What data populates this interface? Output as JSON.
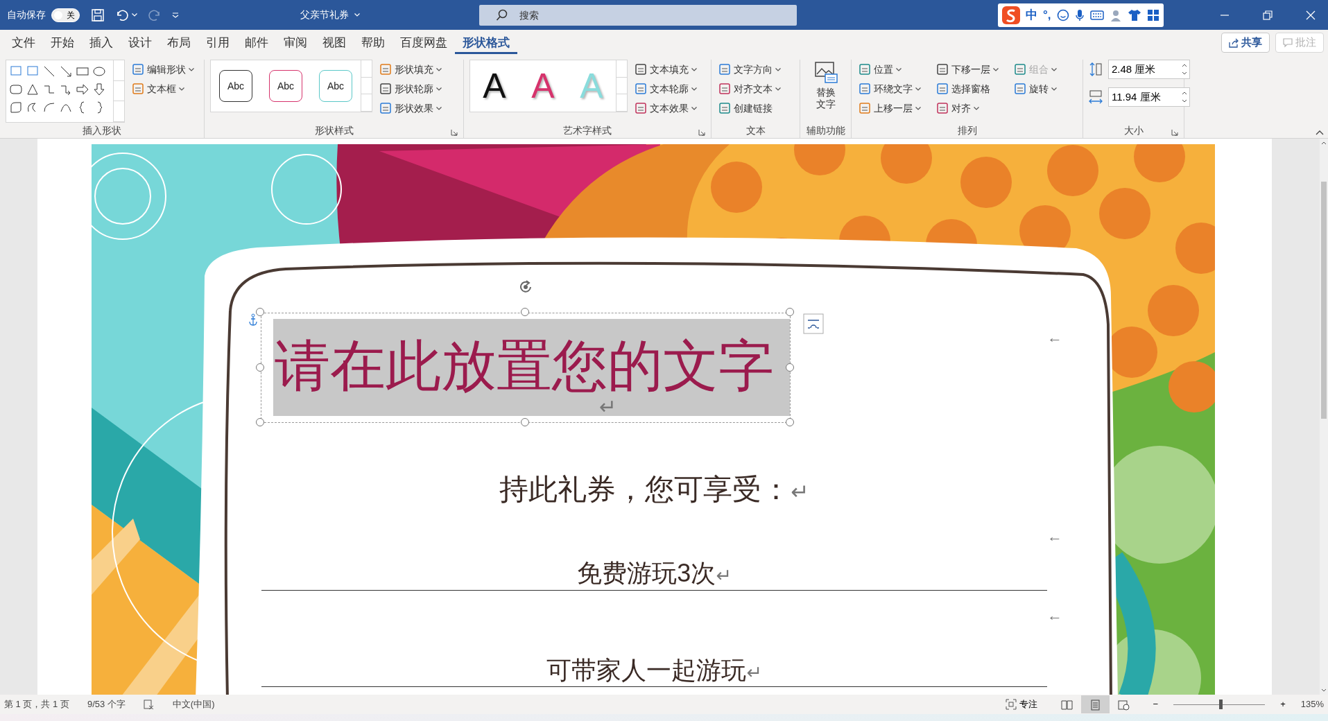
{
  "title_bar": {
    "autosave_label": "自动保存",
    "autosave": {
      "on": false,
      "label": "关"
    },
    "document_title": "父亲节礼券",
    "search": {
      "placeholder": "搜索"
    },
    "ime_items": [
      "中",
      "°,"
    ]
  },
  "menu_tabs": [
    {
      "label": "文件",
      "selected": false
    },
    {
      "label": "开始",
      "selected": false
    },
    {
      "label": "插入",
      "selected": false
    },
    {
      "label": "设计",
      "selected": false
    },
    {
      "label": "布局",
      "selected": false
    },
    {
      "label": "引用",
      "selected": false
    },
    {
      "label": "邮件",
      "selected": false
    },
    {
      "label": "审阅",
      "selected": false
    },
    {
      "label": "视图",
      "selected": false
    },
    {
      "label": "帮助",
      "selected": false
    },
    {
      "label": "百度网盘",
      "selected": false
    },
    {
      "label": "形状格式",
      "selected": true
    }
  ],
  "share_button": "共享",
  "comment_button": {
    "label": "批注",
    "disabled": true
  },
  "ribbon": {
    "groups": [
      {
        "label": "插入形状",
        "kind": "shapes",
        "launcher": false,
        "commands": [
          {
            "label": "编辑形状",
            "dropdown": true
          },
          {
            "label": "文本框",
            "dropdown": true
          }
        ]
      },
      {
        "label": "形状样式",
        "kind": "styles",
        "launcher": true,
        "styles": [
          {
            "label": "Abc",
            "color": "#333333"
          },
          {
            "label": "Abc",
            "color": "#d6336c"
          },
          {
            "label": "Abc",
            "color": "#5bc8c8"
          }
        ],
        "commands": [
          {
            "label": "形状填充",
            "dropdown": true
          },
          {
            "label": "形状轮廓",
            "dropdown": true
          },
          {
            "label": "形状效果",
            "dropdown": true
          }
        ]
      },
      {
        "label": "艺术字样式",
        "kind": "wordart",
        "launcher": true,
        "styles": [
          {
            "label": "A",
            "color": "#111111"
          },
          {
            "label": "A",
            "color": "#d6336c"
          },
          {
            "label": "A",
            "color": "#8adcdc"
          }
        ],
        "commands": [
          {
            "label": "文本填充",
            "dropdown": true
          },
          {
            "label": "文本轮廓",
            "dropdown": true
          },
          {
            "label": "文本效果",
            "dropdown": true
          }
        ]
      },
      {
        "label": "文本",
        "kind": "list",
        "launcher": false,
        "commands": [
          {
            "label": "文字方向",
            "dropdown": true
          },
          {
            "label": "对齐文本",
            "dropdown": true
          },
          {
            "label": "创建链接",
            "dropdown": false
          }
        ]
      },
      {
        "label": "辅助功能",
        "kind": "large",
        "launcher": false,
        "commands": [
          {
            "label": "替换文字",
            "dropdown": false
          }
        ]
      },
      {
        "label": "排列",
        "kind": "columns",
        "launcher": false,
        "columns": [
          [
            {
              "label": "位置",
              "dropdown": true,
              "disabled": false
            },
            {
              "label": "环绕文字",
              "dropdown": true,
              "disabled": false
            },
            {
              "label": "上移一层",
              "dropdown": true,
              "disabled": false
            }
          ],
          [
            {
              "label": "下移一层",
              "dropdown": true,
              "disabled": false
            },
            {
              "label": "选择窗格",
              "dropdown": false,
              "disabled": false
            },
            {
              "label": "对齐",
              "dropdown": true,
              "disabled": false
            }
          ],
          [
            {
              "label": "组合",
              "dropdown": true,
              "disabled": true
            },
            {
              "label": "旋转",
              "dropdown": true,
              "disabled": false
            }
          ]
        ]
      },
      {
        "label": "大小",
        "kind": "size",
        "launcher": true,
        "fields": [
          {
            "value": "2.48 厘米"
          },
          {
            "value": "11.94 厘米"
          }
        ]
      }
    ]
  },
  "document": {
    "title": {
      "text": "请在此放置您的文字",
      "mark": "↵"
    },
    "lines": [
      {
        "text": "持此礼券，您可享受：",
        "mark": "↵",
        "underline": false
      },
      {
        "text": "免费游玩3次",
        "mark": "↵",
        "underline": true
      },
      {
        "text": "可带家人一起游玩",
        "mark": "↵",
        "underline": true
      }
    ],
    "side_marks": [
      "←",
      "←",
      "←"
    ]
  },
  "status_bar": {
    "items": [
      "第 1 页，共 1 页",
      "9/53 个字",
      "中文(中国)"
    ],
    "focus_label": "专注",
    "views": [
      {
        "selected": false
      },
      {
        "selected": true
      },
      {
        "selected": false
      }
    ],
    "zoom_out": "−",
    "zoom_in": "+",
    "zoom": {
      "level": 0.52,
      "label": "135%"
    }
  }
}
